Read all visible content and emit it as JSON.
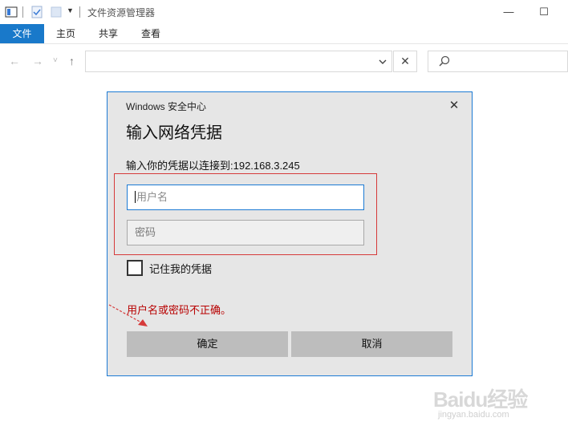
{
  "window": {
    "title": "文件资源管理器",
    "minimize_label": "—",
    "maximize_label": "☐"
  },
  "ribbon": {
    "tabs": [
      {
        "label": "文件"
      },
      {
        "label": "主页"
      },
      {
        "label": "共享"
      },
      {
        "label": "查看"
      }
    ]
  },
  "nav": {
    "back": "←",
    "forward": "→",
    "recent": "˅",
    "up": "↑",
    "address_value": "",
    "clear_label": "✕"
  },
  "dialog": {
    "title": "Windows 安全中心",
    "heading": "输入网络凭据",
    "description": "输入你的凭据以连接到:192.168.3.245",
    "username_placeholder": "用户名",
    "password_placeholder": "密码",
    "remember_label": "记住我的凭据",
    "remember_checked": false,
    "error_message": "用户名或密码不正确。",
    "ok_label": "确定",
    "cancel_label": "取消",
    "close_label": "✕"
  },
  "annotation_colors": {
    "box": "#d63a3a",
    "arrow": "#d63a3a"
  },
  "watermark": {
    "main": "Baidu经验",
    "sub": "jingyan.baidu.com"
  },
  "colors": {
    "accent": "#1979ca",
    "dialog_border": "#1c7ad4",
    "error": "#b80000"
  }
}
